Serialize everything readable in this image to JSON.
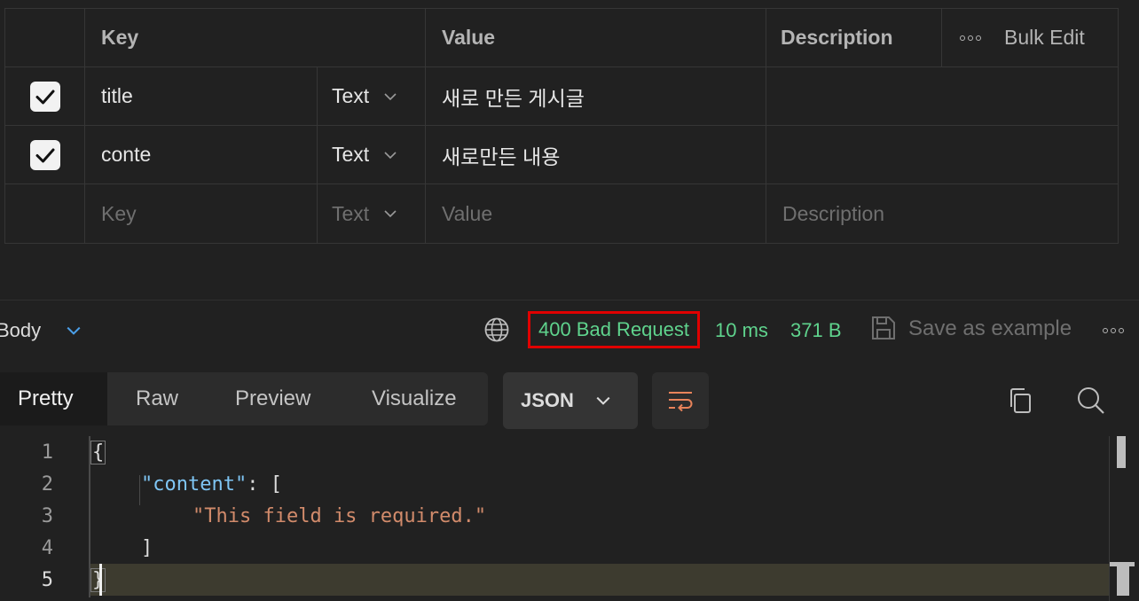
{
  "params": {
    "headers": {
      "key": "Key",
      "value": "Value",
      "description": "Description",
      "bulk_edit": "Bulk Edit"
    },
    "rows": [
      {
        "checked": true,
        "key": "title",
        "type": "Text",
        "value": "새로 만든 게시글",
        "description": ""
      },
      {
        "checked": true,
        "key": "conte",
        "type": "Text",
        "value": "새로만든 내용",
        "description": ""
      }
    ],
    "placeholder_row": {
      "key": "Key",
      "type": "Text",
      "value": "Value",
      "description": "Description"
    }
  },
  "response": {
    "body_label": "Body",
    "status": "400 Bad Request",
    "time": "10 ms",
    "size": "371 B",
    "save_as_example": "Save as example",
    "status_color": "#5fd38d",
    "highlight_color": "#e00000"
  },
  "view": {
    "tabs": [
      "Pretty",
      "Raw",
      "Preview",
      "Visualize"
    ],
    "active_tab": "Pretty",
    "format": "JSON"
  },
  "editor": {
    "line_numbers": [
      "1",
      "2",
      "3",
      "4",
      "5"
    ],
    "lines": {
      "l1": "{",
      "l2_key": "\"content\"",
      "l2_rest": ": [",
      "l3": "\"This field is required.\"",
      "l4": "]",
      "l5": "}"
    }
  }
}
